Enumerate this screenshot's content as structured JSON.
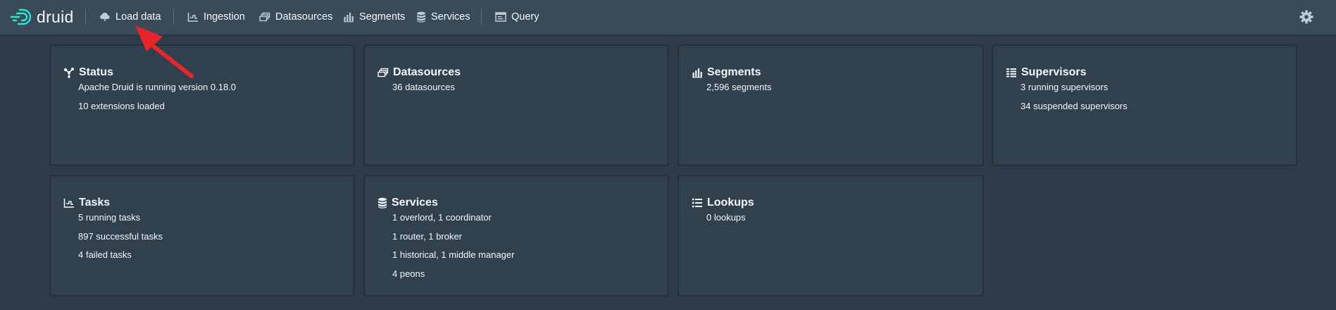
{
  "app": {
    "name": "druid"
  },
  "nav": {
    "items": [
      {
        "label": "Load data",
        "icon": "cloud-upload-icon"
      },
      {
        "label": "Ingestion",
        "icon": "ingestion-chart-icon"
      },
      {
        "label": "Datasources",
        "icon": "datasources-icon"
      },
      {
        "label": "Segments",
        "icon": "segments-icon"
      },
      {
        "label": "Services",
        "icon": "database-icon"
      },
      {
        "label": "Query",
        "icon": "query-application-icon"
      }
    ],
    "settings_icon": "gear-icon"
  },
  "cards": {
    "status": {
      "title": "Status",
      "lines": [
        "Apache Druid is running version 0.18.0",
        "10 extensions loaded"
      ]
    },
    "datasources": {
      "title": "Datasources",
      "lines": [
        "36 datasources"
      ]
    },
    "segments": {
      "title": "Segments",
      "lines": [
        "2,596 segments"
      ]
    },
    "supervisors": {
      "title": "Supervisors",
      "lines": [
        "3 running supervisors",
        "34 suspended supervisors"
      ]
    },
    "tasks": {
      "title": "Tasks",
      "lines": [
        "5 running tasks",
        "897 successful tasks",
        "4 failed tasks"
      ]
    },
    "services": {
      "title": "Services",
      "lines": [
        "1 overlord, 1 coordinator",
        "1 router, 1 broker",
        "1 historical, 1 middle manager",
        "4 peons"
      ]
    },
    "lookups": {
      "title": "Lookups",
      "lines": [
        "0 lookups"
      ]
    }
  },
  "colors": {
    "navbar": "#394b59",
    "background": "#2e3b48",
    "card": "#30404d",
    "logo_accent": "#2ee6d6",
    "annotation_arrow": "#e8262a"
  }
}
